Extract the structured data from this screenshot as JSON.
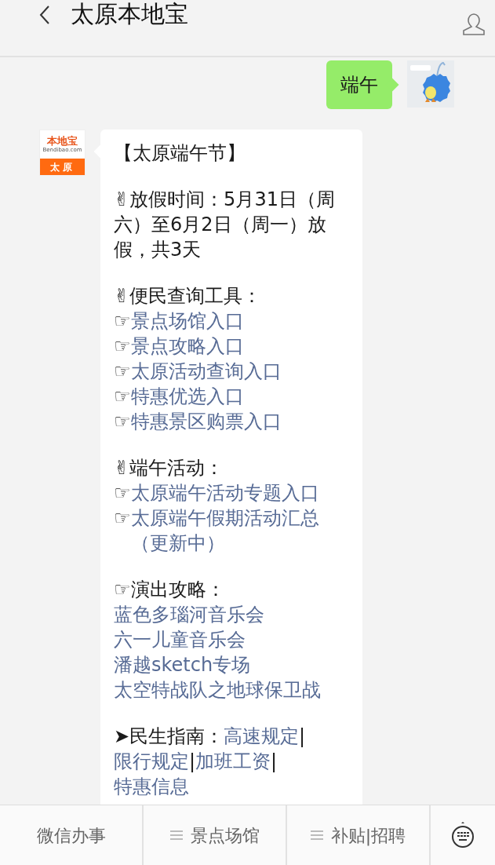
{
  "header": {
    "title": "太原本地宝"
  },
  "messages": [
    {
      "kind": "sent",
      "text": "端午"
    },
    {
      "kind": "received",
      "avatar": {
        "brand": "本地宝",
        "domain": "Bendibao.com",
        "city": "太原"
      },
      "paragraphs": [
        [
          {
            "kind": "text",
            "text": "【太原端午节】"
          }
        ],
        [
          {
            "kind": "text",
            "text": "✌放假时间：5月31日（周六）至6月2日（周一）放假，共3天"
          }
        ],
        [
          {
            "kind": "text",
            "text": "✌便民查询工具："
          },
          {
            "kind": "link",
            "marker": "☞",
            "text": "景点场馆入口"
          },
          {
            "kind": "link",
            "marker": "☞",
            "text": "景点攻略入口"
          },
          {
            "kind": "link",
            "marker": "☞",
            "text": "太原活动查询入口"
          },
          {
            "kind": "link",
            "marker": "☞",
            "text": "特惠优选入口"
          },
          {
            "kind": "link",
            "marker": "☞",
            "text": "特惠景区购票入口"
          }
        ],
        [
          {
            "kind": "text",
            "text": "✌端午活动："
          },
          {
            "kind": "link",
            "marker": "☞",
            "text": "太原端午活动专题入口"
          },
          {
            "kind": "link",
            "marker": "☞",
            "text": "太原端午假期活动汇总（更新中）"
          }
        ],
        [
          {
            "kind": "text",
            "text": "☞演出攻略："
          },
          {
            "kind": "link",
            "text": "蓝色多瑙河音乐会"
          },
          {
            "kind": "link",
            "text": "六一儿童音乐会"
          },
          {
            "kind": "link",
            "text": "潘越sketch专场"
          },
          {
            "kind": "link",
            "text": "太空特战队之地球保卫战"
          }
        ],
        [
          {
            "kind": "inline",
            "parts": [
              {
                "kind": "text",
                "text": "➤民生指南："
              },
              {
                "kind": "link",
                "text": "高速规定"
              },
              {
                "kind": "text",
                "text": "|"
              },
              {
                "kind": "link",
                "text": "限行规定"
              },
              {
                "kind": "text",
                "text": "|"
              },
              {
                "kind": "link",
                "text": "加班工资"
              },
              {
                "kind": "text",
                "text": "|"
              },
              {
                "kind": "link",
                "text": "特惠信息"
              }
            ]
          }
        ]
      ]
    }
  ],
  "bottom_menu": [
    {
      "label": "微信办事",
      "submenu": false
    },
    {
      "label": "景点场馆",
      "submenu": true
    },
    {
      "label": "补贴|招聘",
      "submenu": true
    }
  ]
}
